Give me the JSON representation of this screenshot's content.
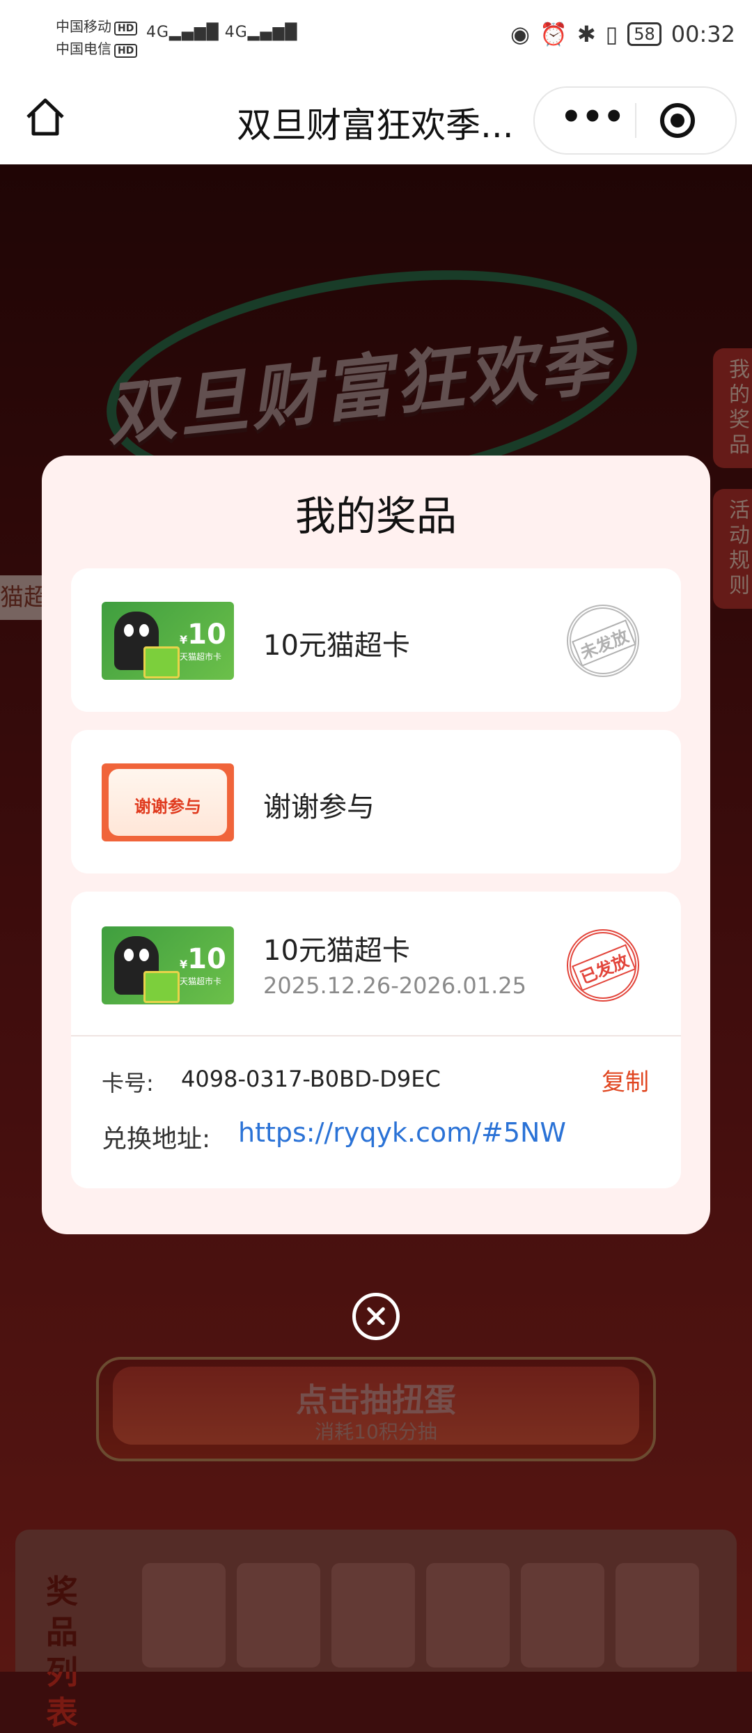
{
  "status_bar": {
    "carrier1": "中国移动",
    "carrier2": "中国电信",
    "hd": "HD",
    "network": "4G",
    "battery": "58",
    "time": "00:32"
  },
  "navbar": {
    "title": "双旦财富狂欢季..."
  },
  "background": {
    "banner_title": "双旦财富狂欢季",
    "side_tab_prizes": "我的奖品",
    "side_tab_rules": "活动规则",
    "ribbon_text": "猫超卡",
    "draw_button": "点击抽扭蛋",
    "draw_sub": "消耗10积分抽",
    "prize_list_label": "奖品列表"
  },
  "modal": {
    "title": "我的奖品",
    "prizes": [
      {
        "name": "10元猫超卡",
        "coupon_value": "10",
        "coupon_currency": "¥",
        "coupon_card_name": "天猫超市卡",
        "status": "未发放"
      },
      {
        "name": "谢谢参与",
        "coupon_text": "谢谢参与"
      },
      {
        "name": "10元猫超卡",
        "coupon_value": "10",
        "coupon_currency": "¥",
        "coupon_card_name": "天猫超市卡",
        "date_range": "2025.12.26-2026.01.25",
        "status": "已发放",
        "card_no_label": "卡号:",
        "card_no": "4098-0317-B0BD-D9EC",
        "copy_label": "复制",
        "address_label": "兑换地址:",
        "address_url": "https://ryqyk.com/#5NW"
      }
    ]
  },
  "colors": {
    "accent_red": "#e0451f",
    "link_blue": "#2a72d6",
    "modal_bg": "#fff1f0"
  },
  "icons": {
    "home": "home-icon",
    "more": "more-dots-icon",
    "target": "target-icon",
    "close": "close-circle-icon"
  }
}
